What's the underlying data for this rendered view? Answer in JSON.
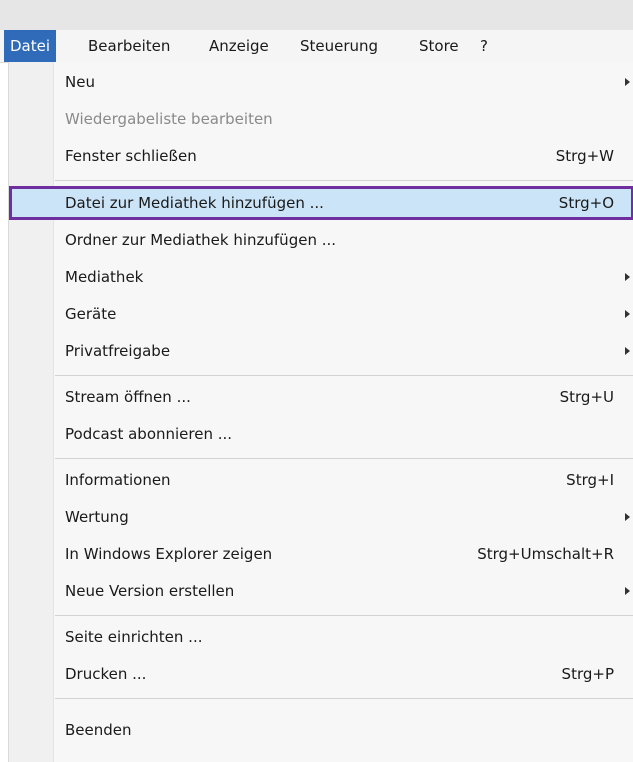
{
  "menubar": {
    "items": [
      {
        "label": "Datei"
      },
      {
        "label": "Bearbeiten"
      },
      {
        "label": "Anzeige"
      },
      {
        "label": "Steuerung"
      },
      {
        "label": "Store"
      },
      {
        "label": "?"
      }
    ]
  },
  "menu": {
    "items": [
      {
        "label": "Neu",
        "shortcut": "",
        "submenu": true,
        "enabled": true
      },
      {
        "label": "Wiedergabeliste bearbeiten",
        "shortcut": "",
        "submenu": false,
        "enabled": false
      },
      {
        "label": "Fenster schließen",
        "shortcut": "Strg+W",
        "submenu": false,
        "enabled": true
      },
      {
        "label": "Datei zur Mediathek hinzufügen ...",
        "shortcut": "Strg+O",
        "submenu": false,
        "enabled": true,
        "highlighted": true
      },
      {
        "label": "Ordner zur Mediathek hinzufügen ...",
        "shortcut": "",
        "submenu": false,
        "enabled": true
      },
      {
        "label": "Mediathek",
        "shortcut": "",
        "submenu": true,
        "enabled": true
      },
      {
        "label": "Geräte",
        "shortcut": "",
        "submenu": true,
        "enabled": true
      },
      {
        "label": "Privatfreigabe",
        "shortcut": "",
        "submenu": true,
        "enabled": true
      },
      {
        "label": "Stream öffnen ...",
        "shortcut": "Strg+U",
        "submenu": false,
        "enabled": true
      },
      {
        "label": "Podcast abonnieren ...",
        "shortcut": "",
        "submenu": false,
        "enabled": true
      },
      {
        "label": "Informationen",
        "shortcut": "Strg+I",
        "submenu": false,
        "enabled": true
      },
      {
        "label": "Wertung",
        "shortcut": "",
        "submenu": true,
        "enabled": true
      },
      {
        "label": "In Windows Explorer zeigen",
        "shortcut": "Strg+Umschalt+R",
        "submenu": false,
        "enabled": true
      },
      {
        "label": "Neue Version erstellen",
        "shortcut": "",
        "submenu": true,
        "enabled": true
      },
      {
        "label": "Seite einrichten ...",
        "shortcut": "",
        "submenu": false,
        "enabled": true
      },
      {
        "label": "Drucken ...",
        "shortcut": "Strg+P",
        "submenu": false,
        "enabled": true
      },
      {
        "label": "Beenden",
        "shortcut": "",
        "submenu": false,
        "enabled": true
      }
    ]
  },
  "colors": {
    "menubar_active": "#2f6bb8",
    "highlight_fill": "#cce4f7",
    "highlight_border": "#6f2f9f",
    "disabled_text": "#8a8a8a"
  }
}
